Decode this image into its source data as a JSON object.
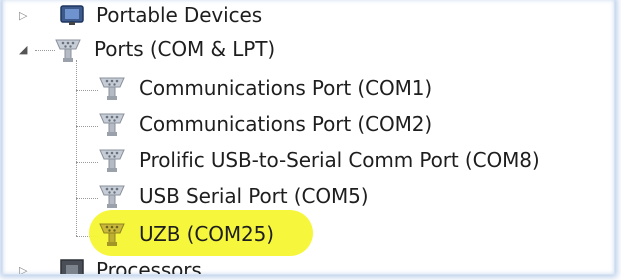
{
  "tree": {
    "portable_devices": {
      "label": "Portable Devices",
      "expander": "▷",
      "icon": "portable-device-icon"
    },
    "ports": {
      "label": "Ports (COM & LPT)",
      "expander": "◢",
      "icon": "serial-port-icon",
      "children": [
        {
          "label": "Communications Port (COM1)",
          "icon": "serial-port-icon"
        },
        {
          "label": "Communications Port (COM2)",
          "icon": "serial-port-icon"
        },
        {
          "label": "Prolific USB-to-Serial Comm Port (COM8)",
          "icon": "serial-port-icon"
        },
        {
          "label": "USB Serial Port (COM5)",
          "icon": "serial-port-icon"
        },
        {
          "label": "UZB (COM25)",
          "icon": "serial-port-icon",
          "highlighted": true
        }
      ]
    },
    "processors": {
      "label": "Processors",
      "expander": "▷",
      "icon": "processor-icon"
    }
  },
  "colors": {
    "highlight": "#f5f732",
    "frame_glow": "#78a0d7",
    "text": "#1e1e1e"
  }
}
